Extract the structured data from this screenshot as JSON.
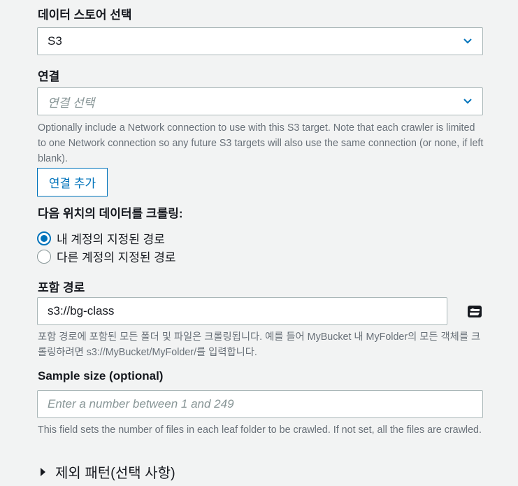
{
  "datastore": {
    "label": "데이터 스토어 선택",
    "value": "S3"
  },
  "connection": {
    "label": "연결",
    "placeholder": "연결 선택",
    "help": "Optionally include a Network connection to use with this S3 target. Note that each crawler is limited to one Network connection so any future S3 targets will also use the same connection (or none, if left blank).",
    "add_button": "연결 추가"
  },
  "crawl_location": {
    "label": "다음 위치의 데이터를 크롤링:",
    "options": [
      {
        "label": "내 계정의 지정된 경로",
        "selected": true
      },
      {
        "label": "다른 계정의 지정된 경로",
        "selected": false
      }
    ]
  },
  "include_path": {
    "label": "포함 경로",
    "value": "s3://bg-class",
    "help": "포함 경로에 포함된 모든 폴더 및 파일은 크롤링됩니다. 예를 들어 MyBucket 내 MyFolder의 모든 객체를 크롤링하려면 s3://MyBucket/MyFolder/를 입력합니다."
  },
  "sample_size": {
    "label": "Sample size (optional)",
    "placeholder": "Enter a number between 1 and 249",
    "help": "This field sets the number of files in each leaf folder to be crawled. If not set, all the files are crawled."
  },
  "exclude_patterns": {
    "label": "제외 패턴(선택 사항)"
  },
  "colors": {
    "accent": "#0073bb",
    "border": "#aab7b8",
    "help_text": "#687078",
    "background": "#f2f3f3"
  },
  "icons": {
    "dropdown": "chevron-down-icon",
    "browse": "folder-open-icon",
    "expand": "caret-right-icon"
  }
}
